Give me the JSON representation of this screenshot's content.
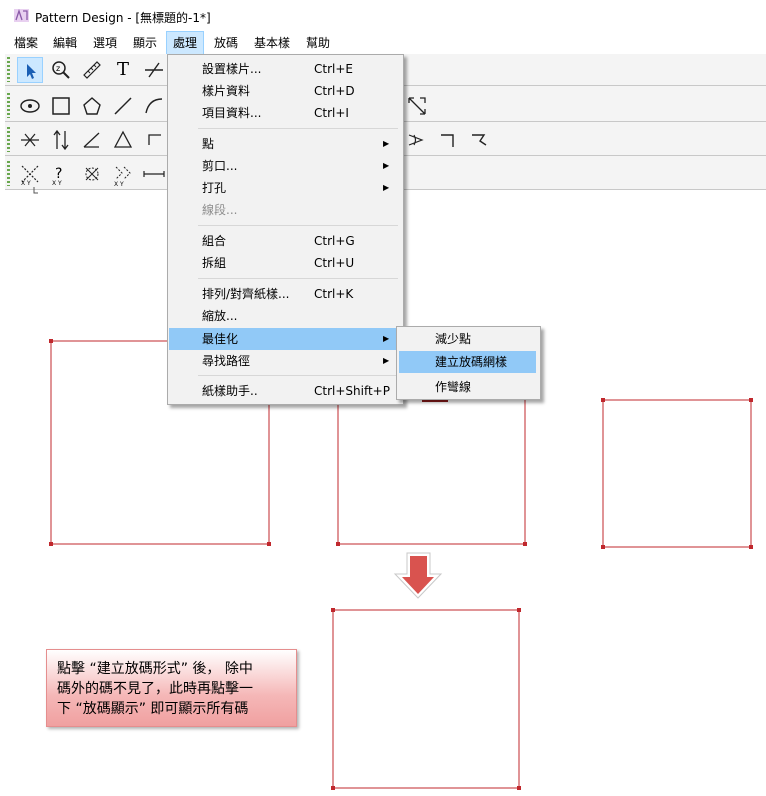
{
  "window": {
    "title": "Pattern Design - [無標題的-1*]",
    "app_icon": "pattern-design-app-icon"
  },
  "menubar": {
    "items": [
      "檔案",
      "編輯",
      "選項",
      "顯示",
      "處理",
      "放碼",
      "基本樣",
      "幫助"
    ],
    "active": "處理"
  },
  "toolbar": {
    "row1": [
      "select-arrow-icon",
      "zoom-icon",
      "ruler-icon",
      "text-icon",
      "cut-line-icon"
    ],
    "row2": [
      "point-circle-icon",
      "rectangle-icon",
      "pentagon-icon",
      "line-icon",
      "curve-icon",
      "resize-diagonal-icon"
    ],
    "row3": [
      "notch-icon",
      "parallel-icon",
      "angle-icon",
      "triangle-icon",
      "bracket-icon",
      "cone-icon",
      "corner-icon",
      "corner-slant-icon"
    ],
    "row4": [
      "grade-xy-icon",
      "grade-question-icon",
      "grade-cross-icon",
      "grade-double-icon",
      "grade-line-icon"
    ],
    "text_tool_label": "T"
  },
  "dropdown": {
    "items": [
      {
        "label": "設置樣片...",
        "shortcut": "Ctrl+E"
      },
      {
        "label": "樣片資料",
        "shortcut": "Ctrl+D"
      },
      {
        "label": "項目資料...",
        "shortcut": "Ctrl+I"
      },
      {
        "label": "點",
        "arrow": "▶"
      },
      {
        "label": "剪口...",
        "arrow": "▶"
      },
      {
        "label": "打孔",
        "arrow": "▶"
      },
      {
        "label": "線段...",
        "disabled": true
      },
      {
        "label": "組合",
        "shortcut": "Ctrl+G"
      },
      {
        "label": "拆組",
        "shortcut": "Ctrl+U"
      },
      {
        "label": "排列/對齊紙樣...",
        "shortcut": "Ctrl+K"
      },
      {
        "label": "縮放..."
      },
      {
        "label": "最佳化",
        "arrow": "▶",
        "highlighted": true
      },
      {
        "label": "尋找路徑",
        "arrow": "▶"
      },
      {
        "label": "紙樣助手..",
        "shortcut": "Ctrl+Shift+P"
      }
    ]
  },
  "submenu": {
    "items": [
      {
        "label": "減少點"
      },
      {
        "label": "建立放碼網樣",
        "highlighted": true
      },
      {
        "label": "作彎線"
      }
    ]
  },
  "canvas": {
    "line_color": "#c0282d",
    "pieces": [
      "pattern-piece-left",
      "pattern-piece-middle",
      "pattern-piece-right",
      "pattern-piece-result"
    ]
  },
  "annotation": {
    "line1": "點擊 “建立放碼形式” 後， 除中",
    "line2": "碼外的碼不見了，此時再點擊一",
    "line3": "下 “放碼顯示” 即可顯示所有碼",
    "arrow_color": "#d9534f"
  }
}
